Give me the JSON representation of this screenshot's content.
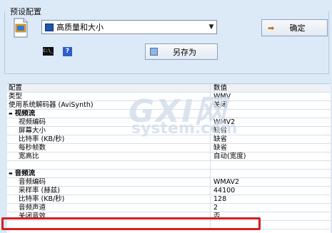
{
  "preset_group": {
    "label": "预设配置",
    "selected_preset": "高质量和大小",
    "ok_label": "确定",
    "save_as_label": "另存为",
    "cmd_icon_text": "C:\\_"
  },
  "table": {
    "header": {
      "name": "配置",
      "value": "数值"
    },
    "rows": [
      {
        "name": "类型",
        "value": "WMV",
        "kind": "plain"
      },
      {
        "name": "使用系统解码器 (AviSynth)",
        "value": "关闭",
        "kind": "plain"
      },
      {
        "name": "视频流",
        "value": "",
        "kind": "category"
      },
      {
        "name": "视频编码",
        "value": "WMV2",
        "kind": "child"
      },
      {
        "name": "屏幕大小",
        "value": "缺省",
        "kind": "child"
      },
      {
        "name": "比特率 (KB/秒)",
        "value": "缺省",
        "kind": "child"
      },
      {
        "name": "每秒帧数",
        "value": "缺省",
        "kind": "child"
      },
      {
        "name": "宽高比",
        "value": "自动(宽度)",
        "kind": "child"
      },
      {
        "name": "",
        "value": "",
        "kind": "child-dim"
      },
      {
        "name": "音频流",
        "value": "",
        "kind": "category"
      },
      {
        "name": "音频编码",
        "value": "WMAV2",
        "kind": "child"
      },
      {
        "name": "采样率 (赫兹)",
        "value": "44100",
        "kind": "child"
      },
      {
        "name": "比特率 (KB/秒)",
        "value": "128",
        "kind": "child"
      },
      {
        "name": "音频声道",
        "value": "2",
        "kind": "child"
      },
      {
        "name": "关闭音效",
        "value": "否",
        "kind": "child"
      },
      {
        "name": "",
        "value": "",
        "kind": "child"
      }
    ]
  },
  "watermark": {
    "main": "GXI网",
    "sub": "system.com"
  },
  "colors": {
    "highlight": "#d31f1f",
    "background": "#dce9f7"
  }
}
